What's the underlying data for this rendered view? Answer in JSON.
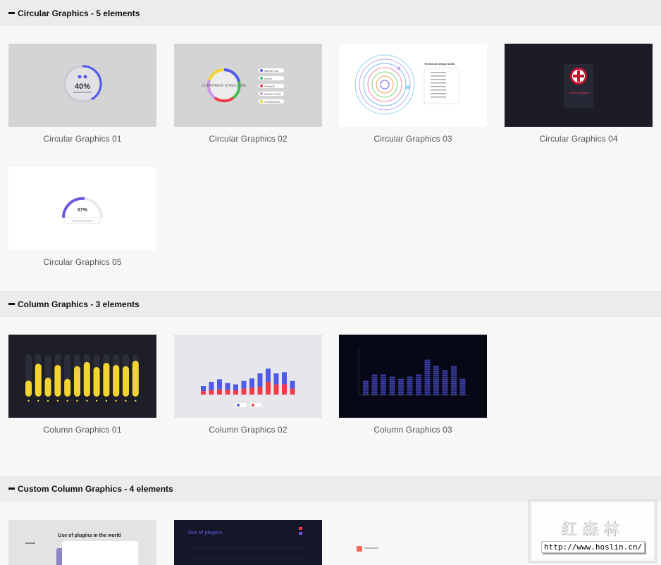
{
  "sections": [
    {
      "title": "Circular Graphics - 5 elements",
      "cards": [
        "Circular Graphics 01",
        "Circular Graphics 02",
        "Circular Graphics 03",
        "Circular Graphics 04",
        "Circular Graphics 05"
      ]
    },
    {
      "title": "Column Graphics - 3 elements",
      "cards": [
        "Column Graphics 01",
        "Column Graphics 02",
        "Column Graphics 03"
      ]
    },
    {
      "title": "Custom Column Graphics - 4 elements",
      "cards": []
    }
  ],
  "thumbs": {
    "circ01_value": "40%",
    "circ02_title": "CORPORATE STRUCTURE",
    "circ02_legend": [
      "MARKETING",
      "SALES",
      "FINANCE",
      "PRODUCTION",
      "OPERATIONS"
    ],
    "circ03_title": "Technical design skills",
    "circ04_title": "United Kingdom",
    "circ05_value": "57%",
    "circ05_caption": "Monthly sale statistics",
    "col01_levels": [
      0.38,
      0.78,
      0.45,
      0.75,
      0.42,
      0.72,
      0.82,
      0.7,
      0.8,
      0.75,
      0.72,
      0.85
    ],
    "col02_bottom": [
      0.2,
      0.25,
      0.3,
      0.28,
      0.25,
      0.35,
      0.4,
      0.45,
      0.75,
      0.6,
      0.6,
      0.35
    ],
    "col02_top": [
      0.3,
      0.5,
      0.6,
      0.4,
      0.35,
      0.45,
      0.55,
      0.8,
      0.78,
      0.65,
      0.72,
      0.45
    ],
    "col03_levels": [
      0.35,
      0.5,
      0.5,
      0.45,
      0.4,
      0.45,
      0.5,
      0.85,
      0.7,
      0.6,
      0.72,
      0.4
    ],
    "custom01_heading": "Use of plugins in the world",
    "custom02_heading": "Use of plugins"
  },
  "watermark": {
    "brand": "红森林",
    "url": "http://www.hoslin.cn/"
  },
  "colors": {
    "header_bg": "#ececec",
    "page_bg": "#f7f7f7",
    "accent_blue": "#4f5ae8",
    "accent_red": "#f03b47",
    "accent_yellow": "#f2d531"
  }
}
